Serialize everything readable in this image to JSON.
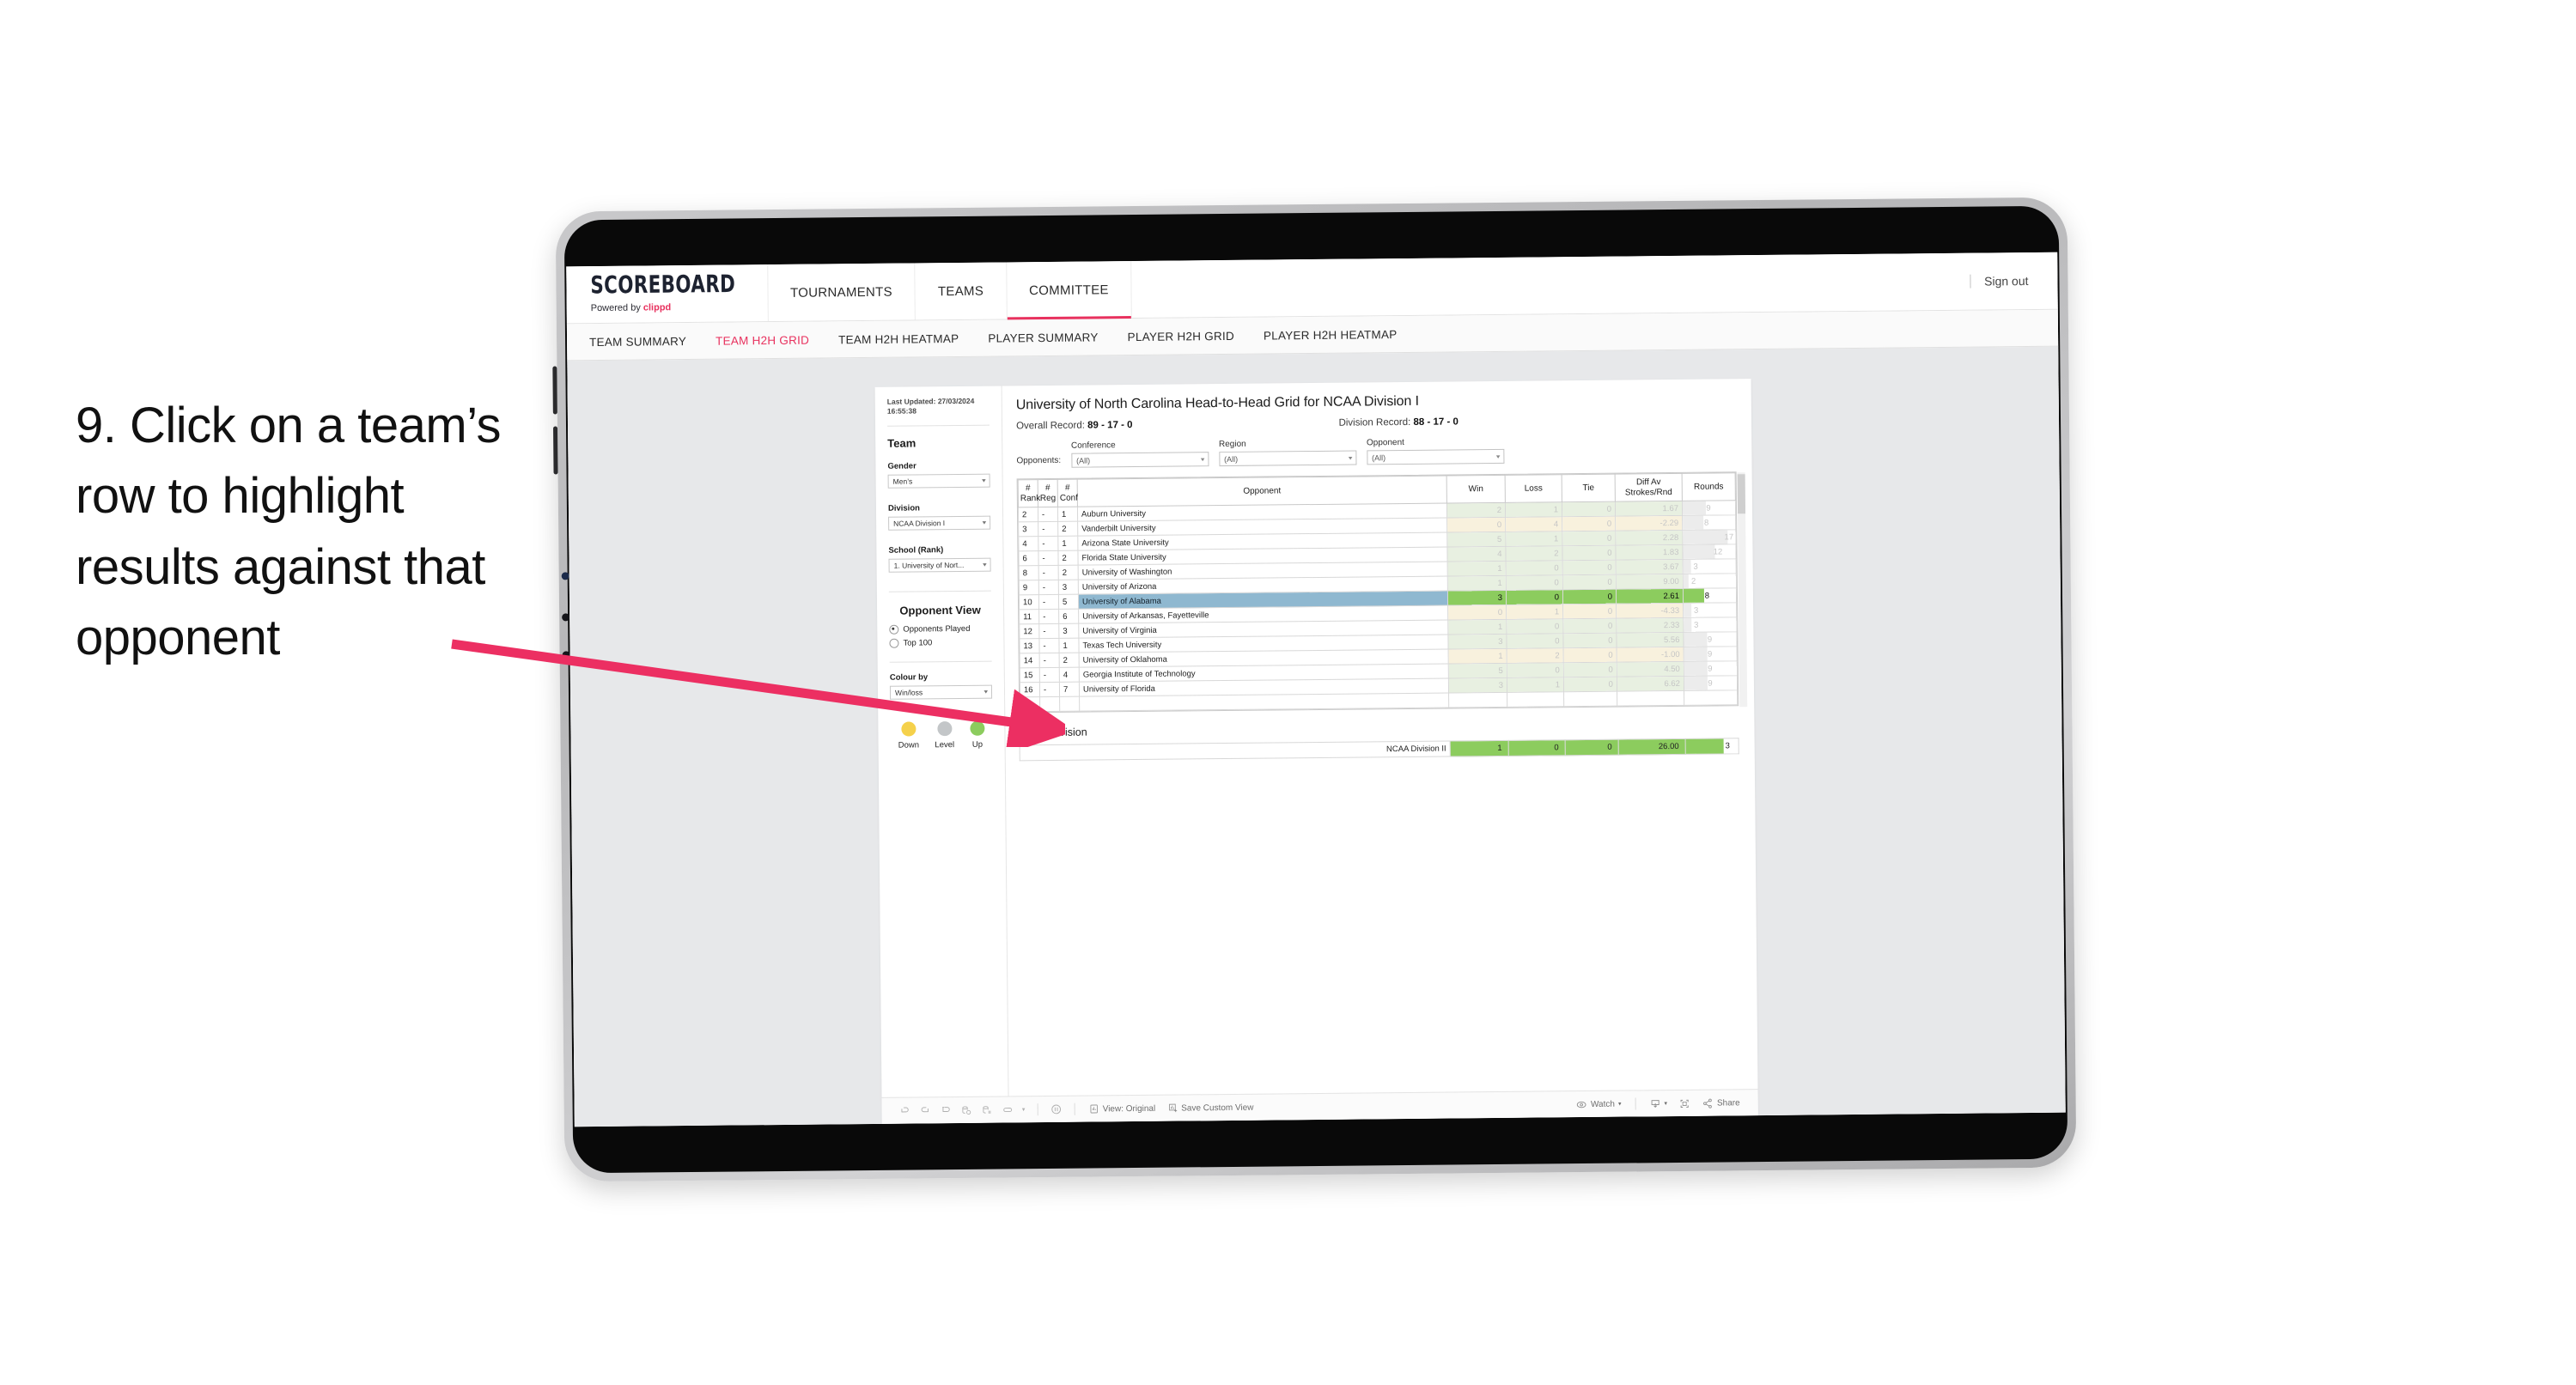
{
  "caption": "9. Click on a team’s row to highlight results against that opponent",
  "annotation": {
    "arrow_color": "#ec2f62"
  },
  "app": {
    "logo": {
      "title": "SCOREBOARD",
      "powered_prefix": "Powered by ",
      "powered_brand": "clippd"
    },
    "nav": [
      {
        "label": "TOURNAMENTS",
        "active": false
      },
      {
        "label": "TEAMS",
        "active": false
      },
      {
        "label": "COMMITTEE",
        "active": true
      }
    ],
    "signout_label": "Sign out",
    "subnav": [
      {
        "label": "TEAM SUMMARY",
        "active": false
      },
      {
        "label": "TEAM H2H GRID",
        "active": true
      },
      {
        "label": "TEAM H2H HEATMAP",
        "active": false
      },
      {
        "label": "PLAYER SUMMARY",
        "active": false
      },
      {
        "label": "PLAYER H2H GRID",
        "active": false
      },
      {
        "label": "PLAYER H2H HEATMAP",
        "active": false
      }
    ]
  },
  "sidebar": {
    "last_updated": "Last Updated: 27/03/2024 16:55:38",
    "team_heading": "Team",
    "gender_label": "Gender",
    "gender_value": "Men’s",
    "division_label": "Division",
    "division_value": "NCAA Division I",
    "school_label": "School (Rank)",
    "school_value": "1. University of Nort...",
    "opponent_view_heading": "Opponent View",
    "opponent_view_options": [
      {
        "label": "Opponents Played",
        "selected": true
      },
      {
        "label": "Top 100",
        "selected": false
      }
    ],
    "colour_by_label": "Colour by",
    "colour_by_value": "Win/loss",
    "legend": [
      {
        "label": "Down",
        "color": "#f5d14b"
      },
      {
        "label": "Level",
        "color": "#c3c6c8"
      },
      {
        "label": "Up",
        "color": "#8ccc5e"
      }
    ]
  },
  "main": {
    "title": "University of North Carolina Head-to-Head Grid for NCAA Division I",
    "overall_record_label": "Overall Record: ",
    "overall_record_value": "89 - 17 - 0",
    "division_record_label": "Division Record: ",
    "division_record_value": "88 - 17 - 0",
    "opponents_label": "Opponents:",
    "filters": [
      {
        "label": "Conference",
        "value": "(All)"
      },
      {
        "label": "Region",
        "value": "(All)"
      },
      {
        "label": "Opponent",
        "value": "(All)"
      }
    ],
    "columns": [
      {
        "line1": "#",
        "line2": "Rank"
      },
      {
        "line1": "#",
        "line2": "Reg"
      },
      {
        "line1": "#",
        "line2": "Conf"
      },
      {
        "line1": "",
        "line2": "Opponent"
      },
      {
        "line1": "",
        "line2": "Win"
      },
      {
        "line1": "",
        "line2": "Loss"
      },
      {
        "line1": "",
        "line2": "Tie"
      },
      {
        "line1": "Diff Av",
        "line2": "Strokes/Rnd"
      },
      {
        "line1": "",
        "line2": "Rounds"
      }
    ],
    "rows": [
      {
        "rank": "2",
        "reg": "-",
        "conf": "1",
        "opponent": "Auburn University",
        "win": "2",
        "loss": "1",
        "tie": "0",
        "diff": "1.67",
        "rounds": "9",
        "tone": "up",
        "highlight": false
      },
      {
        "rank": "3",
        "reg": "-",
        "conf": "2",
        "opponent": "Vanderbilt University",
        "win": "0",
        "loss": "4",
        "tie": "0",
        "diff": "-2.29",
        "rounds": "8",
        "tone": "down",
        "highlight": false
      },
      {
        "rank": "4",
        "reg": "-",
        "conf": "1",
        "opponent": "Arizona State University",
        "win": "5",
        "loss": "1",
        "tie": "0",
        "diff": "2.28",
        "rounds": "17",
        "tone": "up",
        "highlight": false
      },
      {
        "rank": "6",
        "reg": "-",
        "conf": "2",
        "opponent": "Florida State University",
        "win": "4",
        "loss": "2",
        "tie": "0",
        "diff": "1.83",
        "rounds": "12",
        "tone": "up",
        "highlight": false
      },
      {
        "rank": "8",
        "reg": "-",
        "conf": "2",
        "opponent": "University of Washington",
        "win": "1",
        "loss": "0",
        "tie": "0",
        "diff": "3.67",
        "rounds": "3",
        "tone": "up",
        "highlight": false
      },
      {
        "rank": "9",
        "reg": "-",
        "conf": "3",
        "opponent": "University of Arizona",
        "win": "1",
        "loss": "0",
        "tie": "0",
        "diff": "9.00",
        "rounds": "2",
        "tone": "up",
        "highlight": false
      },
      {
        "rank": "10",
        "reg": "-",
        "conf": "5",
        "opponent": "University of Alabama",
        "win": "3",
        "loss": "0",
        "tie": "0",
        "diff": "2.61",
        "rounds": "8",
        "tone": "up",
        "highlight": true
      },
      {
        "rank": "11",
        "reg": "-",
        "conf": "6",
        "opponent": "University of Arkansas, Fayetteville",
        "win": "0",
        "loss": "1",
        "tie": "0",
        "diff": "-4.33",
        "rounds": "3",
        "tone": "down",
        "highlight": false
      },
      {
        "rank": "12",
        "reg": "-",
        "conf": "3",
        "opponent": "University of Virginia",
        "win": "1",
        "loss": "0",
        "tie": "0",
        "diff": "2.33",
        "rounds": "3",
        "tone": "up",
        "highlight": false
      },
      {
        "rank": "13",
        "reg": "-",
        "conf": "1",
        "opponent": "Texas Tech University",
        "win": "3",
        "loss": "0",
        "tie": "0",
        "diff": "5.56",
        "rounds": "9",
        "tone": "up",
        "highlight": false
      },
      {
        "rank": "14",
        "reg": "-",
        "conf": "2",
        "opponent": "University of Oklahoma",
        "win": "1",
        "loss": "2",
        "tie": "0",
        "diff": "-1.00",
        "rounds": "9",
        "tone": "down",
        "highlight": false
      },
      {
        "rank": "15",
        "reg": "-",
        "conf": "4",
        "opponent": "Georgia Institute of Technology",
        "win": "5",
        "loss": "0",
        "tie": "0",
        "diff": "4.50",
        "rounds": "9",
        "tone": "up",
        "highlight": false
      },
      {
        "rank": "16",
        "reg": "-",
        "conf": "7",
        "opponent": "University of Florida",
        "win": "3",
        "loss": "1",
        "tie": "0",
        "diff": "6.62",
        "rounds": "9",
        "tone": "up",
        "highlight": false
      }
    ],
    "out_of_division_heading": "Out of division",
    "out_of_division_rows": [
      {
        "label": "NCAA Division II",
        "win": "1",
        "loss": "0",
        "tie": "0",
        "diff": "26.00",
        "rounds": "3"
      }
    ]
  },
  "toolbar": {
    "view_label": "View: Original",
    "save_label": "Save Custom View",
    "watch_label": "Watch",
    "share_label": "Share"
  },
  "colors": {
    "accent": "#e8315e",
    "highlight_row": "#8fb8d0",
    "green_strong": "#8ccc5e",
    "green_faded": "#e7f0e0",
    "amber_faded": "#f7f0dc",
    "rounds_faded": "#ececec"
  }
}
